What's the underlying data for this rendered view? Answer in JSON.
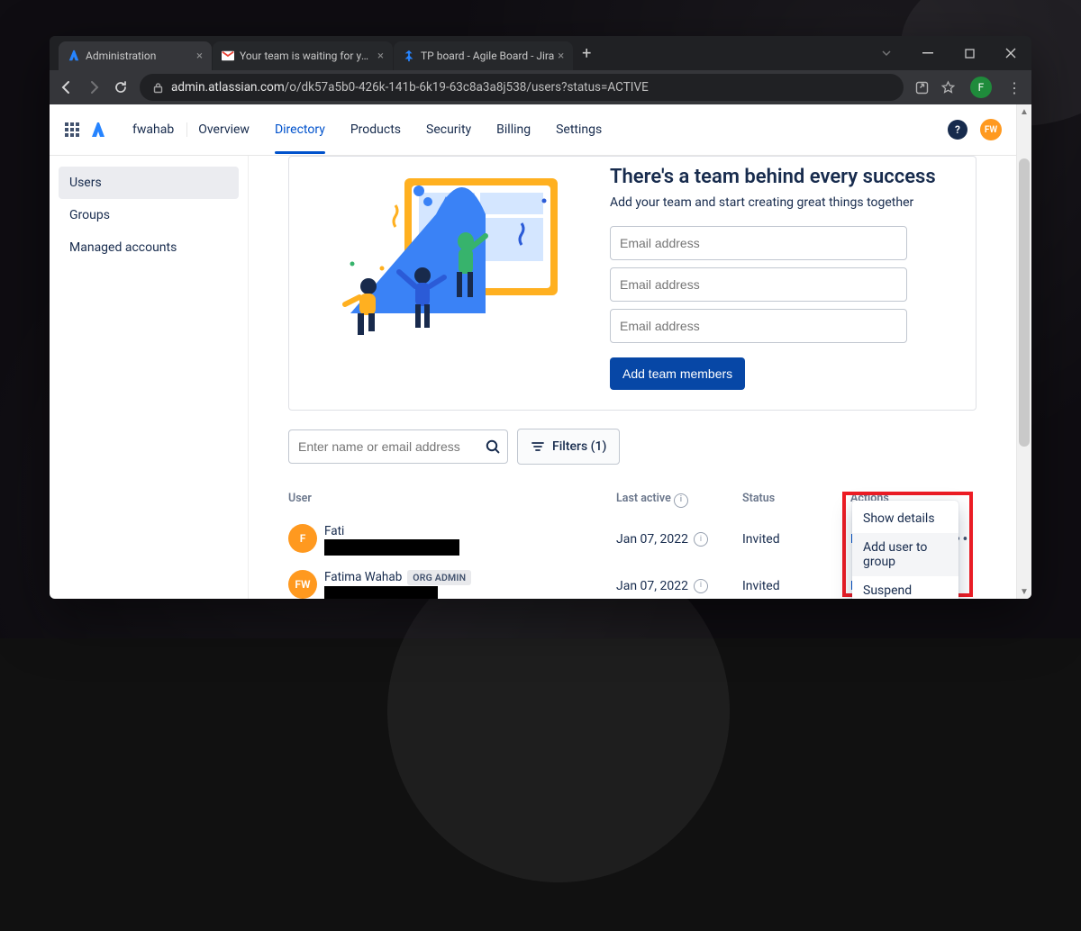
{
  "browser": {
    "tabs": [
      {
        "label": "Administration"
      },
      {
        "label": "Your team is waiting for you to jo"
      },
      {
        "label": "TP board - Agile Board - Jira"
      }
    ],
    "url_domain": "admin.atlassian.com",
    "url_path": "/o/dk57a5b0-426k-141b-6k19-63c8a3a8j538/users?status=ACTIVE",
    "profile_initial": "F"
  },
  "nav": {
    "org": "fwahab",
    "items": [
      "Overview",
      "Directory",
      "Products",
      "Security",
      "Billing",
      "Settings"
    ],
    "selected_index": 1,
    "avatar": "FW"
  },
  "sidebar": {
    "items": [
      "Users",
      "Groups",
      "Managed accounts"
    ],
    "selected_index": 0
  },
  "banner": {
    "title": "There's a team behind every success",
    "subtitle": "Add your team and start creating great things together",
    "placeholder": "Email address",
    "button": "Add team members"
  },
  "toolbar": {
    "search_placeholder": "Enter name or email address",
    "filters_label": "Filters (1)"
  },
  "table": {
    "headers": {
      "user": "User",
      "last_active": "Last active",
      "status": "Status",
      "actions": "Actions"
    },
    "rows": [
      {
        "avatar": "F",
        "avatar_bg": "#ff991f",
        "name": "Fati",
        "badge": "",
        "last_active": "Jan 07, 2022",
        "status": "Invited",
        "action": "Resend invite"
      },
      {
        "avatar": "FW",
        "avatar_bg": "#ff991f",
        "name": "Fatima Wahab",
        "badge": "ORG ADMIN",
        "last_active": "Jan 07, 2022",
        "status": "Invited",
        "action": "Re"
      }
    ],
    "page": "1"
  },
  "menu": {
    "items": [
      "Show details",
      "Add user to group",
      "Suspend access"
    ],
    "hover_index": 1
  }
}
